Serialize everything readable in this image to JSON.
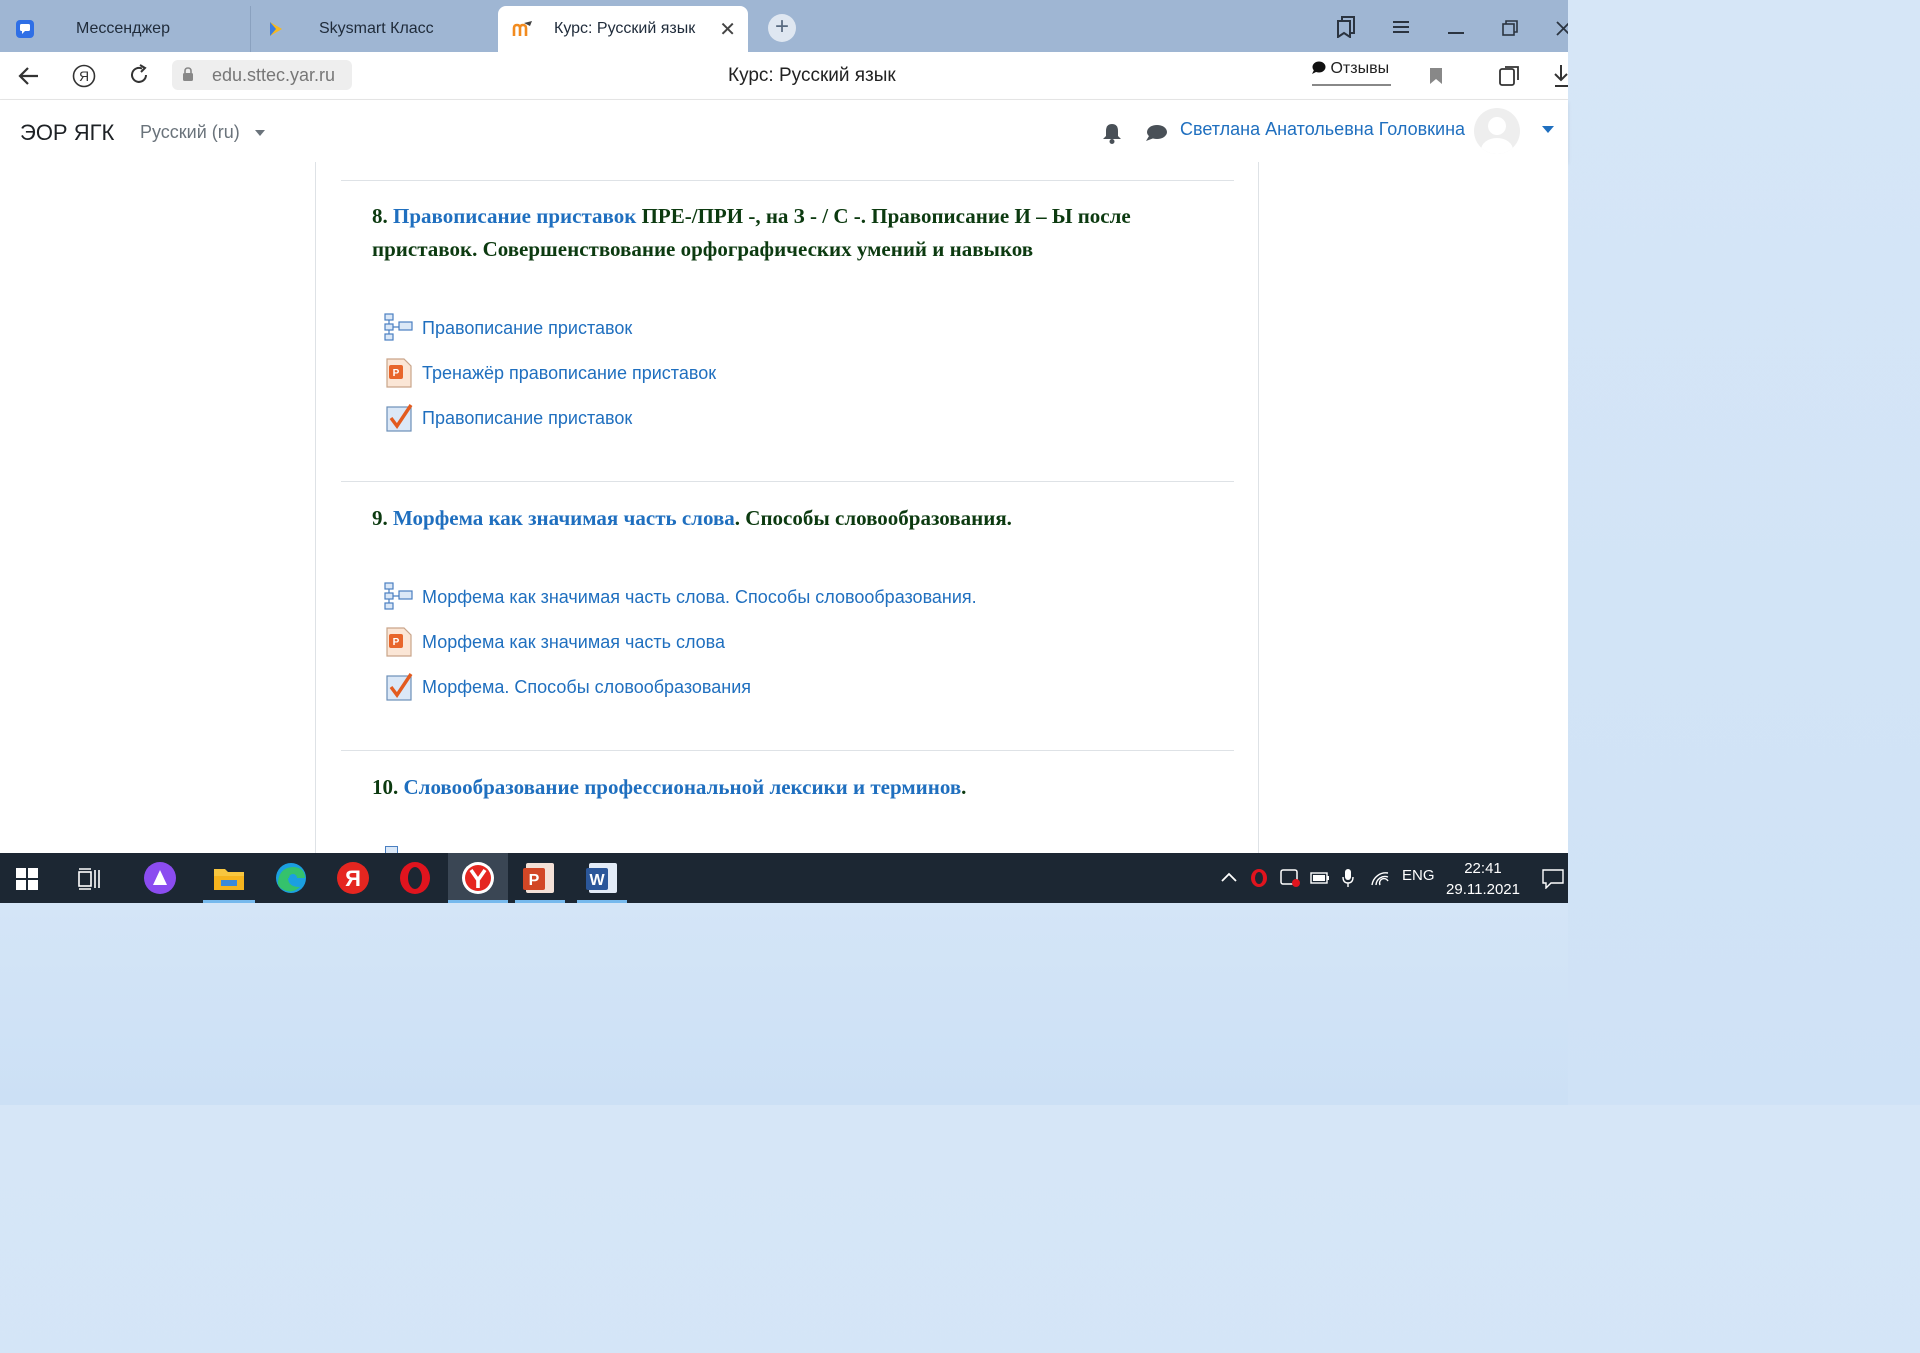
{
  "browser": {
    "tabs": [
      {
        "label": "Мессенджер",
        "icon": "messenger-icon"
      },
      {
        "label": "Skysmart Класс",
        "icon": "skysmart-icon"
      },
      {
        "label": "Курс: Русский язык",
        "icon": "moodle-icon",
        "active": true
      }
    ],
    "close_glyph": "✕",
    "new_tab_glyph": "+",
    "url": "edu.sttec.yar.ru",
    "page_title": "Курс: Русский язык",
    "reviews_label": "Отзывы"
  },
  "navbar": {
    "brand": "ЭОР ЯГК",
    "language": "Русский (ru)",
    "user_name": "Светлана Анатольевна Головкина"
  },
  "sections": [
    {
      "number": "8.",
      "title_link": "Правописание приставок",
      "title_rest": " ПРЕ-/ПРИ -, на З - / С -. Правописание И – Ы после приставок. Совершенствование орфографических умений и навыков",
      "activities": [
        {
          "label": "Правописание приставок",
          "icon": "book-icon"
        },
        {
          "label": "Тренажёр правописание приставок",
          "icon": "powerpoint-file-icon"
        },
        {
          "label": "Правописание приставок",
          "icon": "quiz-checkmark-icon"
        }
      ]
    },
    {
      "number": "9.",
      "title_link": "Морфема как значимая часть слова",
      "title_rest": ".  Способы словообразования.",
      "activities": [
        {
          "label": "Морфема как значимая часть слова. Способы словообразования.",
          "icon": "book-icon"
        },
        {
          "label": "Морфема как значимая часть слова",
          "icon": "powerpoint-file-icon"
        },
        {
          "label": "Морфема. Способы словообразования",
          "icon": "quiz-checkmark-icon"
        }
      ]
    },
    {
      "number": "10.",
      "title_link": "Словообразование профессиональной лексики и терминов",
      "title_rest": ".",
      "activities": []
    }
  ],
  "taskbar": {
    "language": "ENG",
    "time": "22:41",
    "date": "29.11.2021"
  },
  "colors": {
    "link": "#1f6fbf",
    "section_title": "#0c3a10",
    "taskbar": "#1c2733",
    "tabstrip": "#9fb6d3"
  }
}
